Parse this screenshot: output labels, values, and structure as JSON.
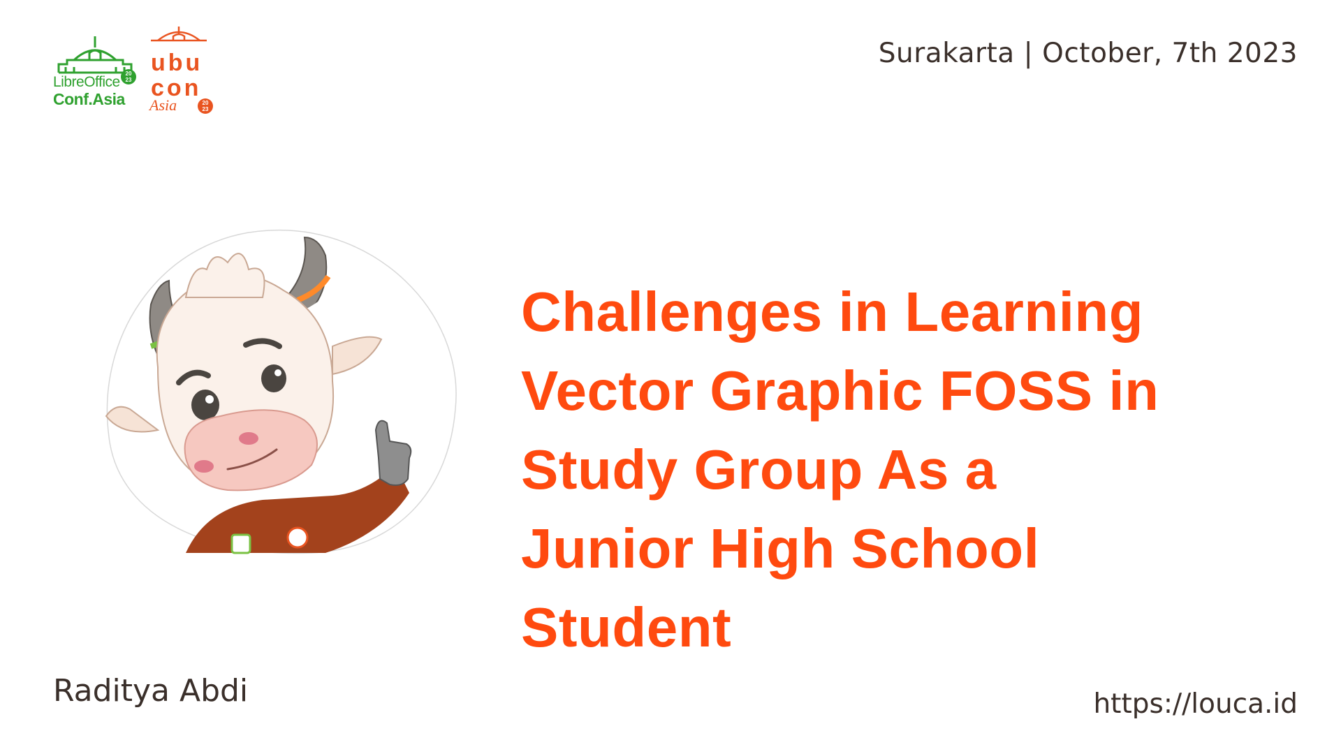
{
  "logos": {
    "libreoffice": {
      "line1": "LibreOffice",
      "line2": "Conf.Asia",
      "year": "2023",
      "color": "#2fa12f"
    },
    "ubucon": {
      "line1": "ubu",
      "line2": "con",
      "line3": "Asia",
      "year": "2023",
      "color": "#e95420"
    }
  },
  "header": {
    "location_date": "Surakarta | October, 7th 2023"
  },
  "slide": {
    "title_lines": [
      "Challenges in Learning",
      "Vector Graphic FOSS in",
      "Study Group As a",
      "Junior High School",
      "Student"
    ],
    "author": "Raditya Abdi",
    "url": "https://louca.id",
    "title_color": "#ff4a0f"
  },
  "mascot": {
    "icon": "cow-mascot-illustration"
  }
}
